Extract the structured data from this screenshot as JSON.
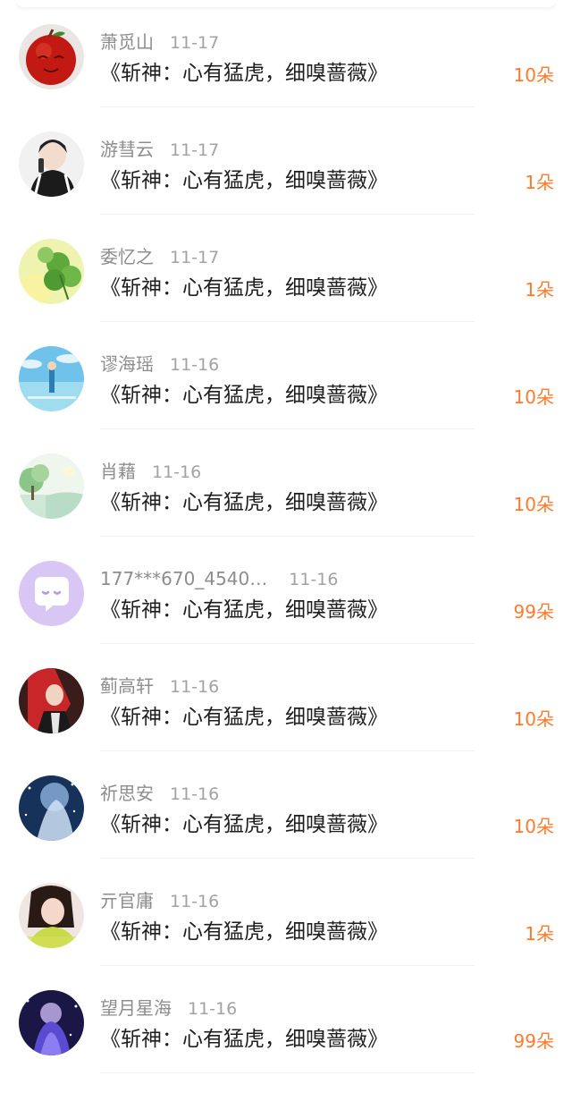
{
  "rows": [
    {
      "name": "萧觅山",
      "date": "11-17",
      "gift": "《斩神：心有猛虎，细嗅蔷薇》",
      "count": "10朵",
      "avatar": "apple-avatar"
    },
    {
      "name": "游彗云",
      "date": "11-17",
      "gift": "《斩神：心有猛虎，细嗅蔷薇》",
      "count": "1朵",
      "avatar": "girl-phone-avatar"
    },
    {
      "name": "委忆之",
      "date": "11-17",
      "gift": "《斩神：心有猛虎，细嗅蔷薇》",
      "count": "1朵",
      "avatar": "clover-avatar"
    },
    {
      "name": "谬海瑶",
      "date": "11-16",
      "gift": "《斩神：心有猛虎，细嗅蔷薇》",
      "count": "10朵",
      "avatar": "sky-sea-avatar"
    },
    {
      "name": "肖藉",
      "date": "11-16",
      "gift": "《斩神：心有猛虎，细嗅蔷薇》",
      "count": "10朵",
      "avatar": "landscape-avatar"
    },
    {
      "name": "177***670_4540…",
      "date": "11-16",
      "gift": "《斩神：心有猛虎，细嗅蔷薇》",
      "count": "99朵",
      "avatar": "default-chat-avatar"
    },
    {
      "name": "蓟高轩",
      "date": "11-16",
      "gift": "《斩神：心有猛虎，细嗅蔷薇》",
      "count": "10朵",
      "avatar": "red-hair-avatar"
    },
    {
      "name": "祈思安",
      "date": "11-16",
      "gift": "《斩神：心有猛虎，细嗅蔷薇》",
      "count": "10朵",
      "avatar": "blue-night-avatar"
    },
    {
      "name": "亓官庸",
      "date": "11-16",
      "gift": "《斩神：心有猛虎，细嗅蔷薇》",
      "count": "1朵",
      "avatar": "girl-portrait-avatar"
    },
    {
      "name": "望月星海",
      "date": "11-16",
      "gift": "《斩神：心有猛虎，细嗅蔷薇》",
      "count": "99朵",
      "avatar": "anime-night-avatar"
    }
  ],
  "colors": {
    "count": "#ff7a2b",
    "name": "#8d8d8d",
    "date": "#a3a3a3",
    "gift": "#1e1e1e",
    "divider": "#efefef"
  }
}
